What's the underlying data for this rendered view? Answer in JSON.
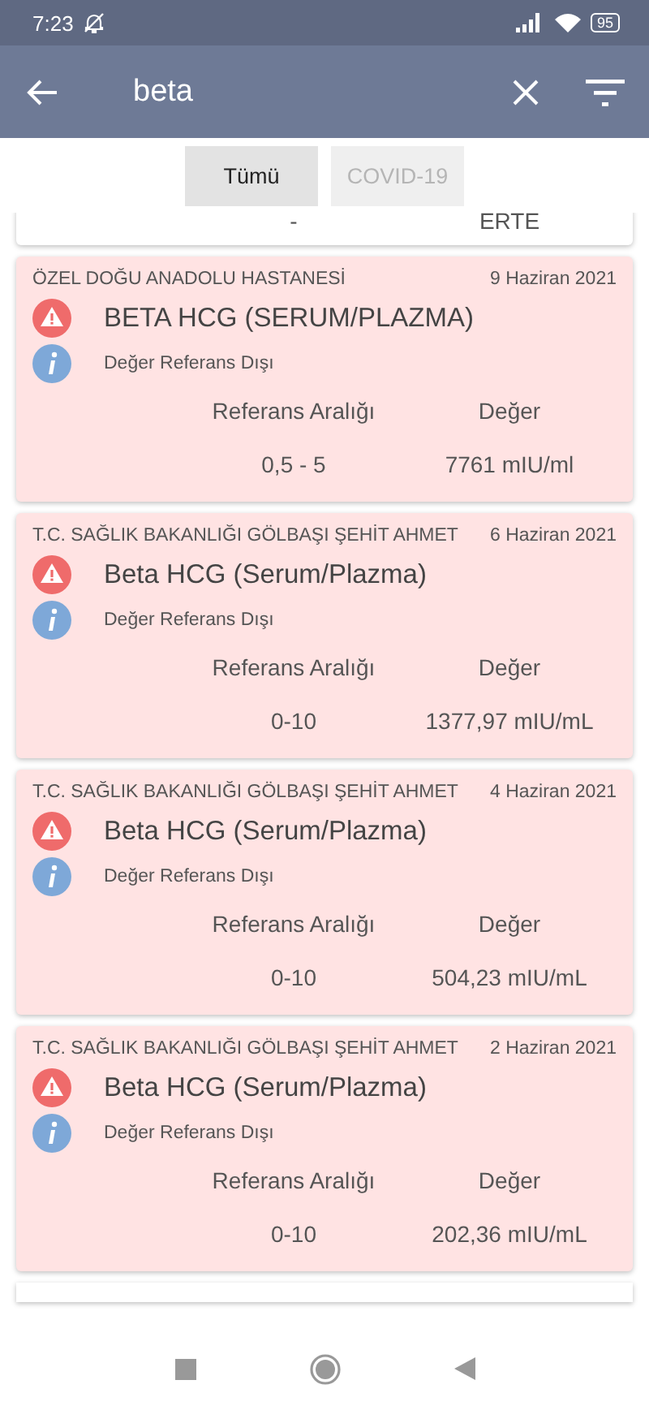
{
  "status_bar": {
    "time": "7:23",
    "battery": "95"
  },
  "app_bar": {
    "search_value": "beta"
  },
  "filters": [
    {
      "label": "Tümü",
      "selected": true
    },
    {
      "label": "COVID-19",
      "selected": false
    }
  ],
  "results": [
    {
      "kind": "partial",
      "range": "-",
      "value": "ERTE"
    },
    {
      "kind": "full",
      "hospital": "ÖZEL DOĞU ANADOLU HASTANESİ",
      "date": "9 Haziran 2021",
      "test": "BETA HCG (SERUM/PLAZMA)",
      "note": "Değer Referans Dışı",
      "range_label": "Referans Aralığı",
      "value_label": "Değer",
      "range": "0,5 - 5",
      "value": "7761 mIU/ml"
    },
    {
      "kind": "full",
      "hospital": "T.C. SAĞLIK BAKANLIĞI GÖLBAŞI ŞEHİT AHMET",
      "date": "6 Haziran 2021",
      "test": "Beta HCG (Serum/Plazma)",
      "note": "Değer Referans Dışı",
      "range_label": "Referans Aralığı",
      "value_label": "Değer",
      "range": "0-10",
      "value": "1377,97 mIU/mL"
    },
    {
      "kind": "full",
      "hospital": "T.C. SAĞLIK BAKANLIĞI GÖLBAŞI ŞEHİT AHMET",
      "date": "4 Haziran 2021",
      "test": "Beta HCG (Serum/Plazma)",
      "note": "Değer Referans Dışı",
      "range_label": "Referans Aralığı",
      "value_label": "Değer",
      "range": "0-10",
      "value": "504,23 mIU/mL"
    },
    {
      "kind": "full",
      "hospital": "T.C. SAĞLIK BAKANLIĞI GÖLBAŞI ŞEHİT AHMET",
      "date": "2 Haziran 2021",
      "test": "Beta HCG (Serum/Plazma)",
      "note": "Değer Referans Dışı",
      "range_label": "Referans Aralığı",
      "value_label": "Değer",
      "range": "0-10",
      "value": "202,36 mIU/mL"
    }
  ]
}
